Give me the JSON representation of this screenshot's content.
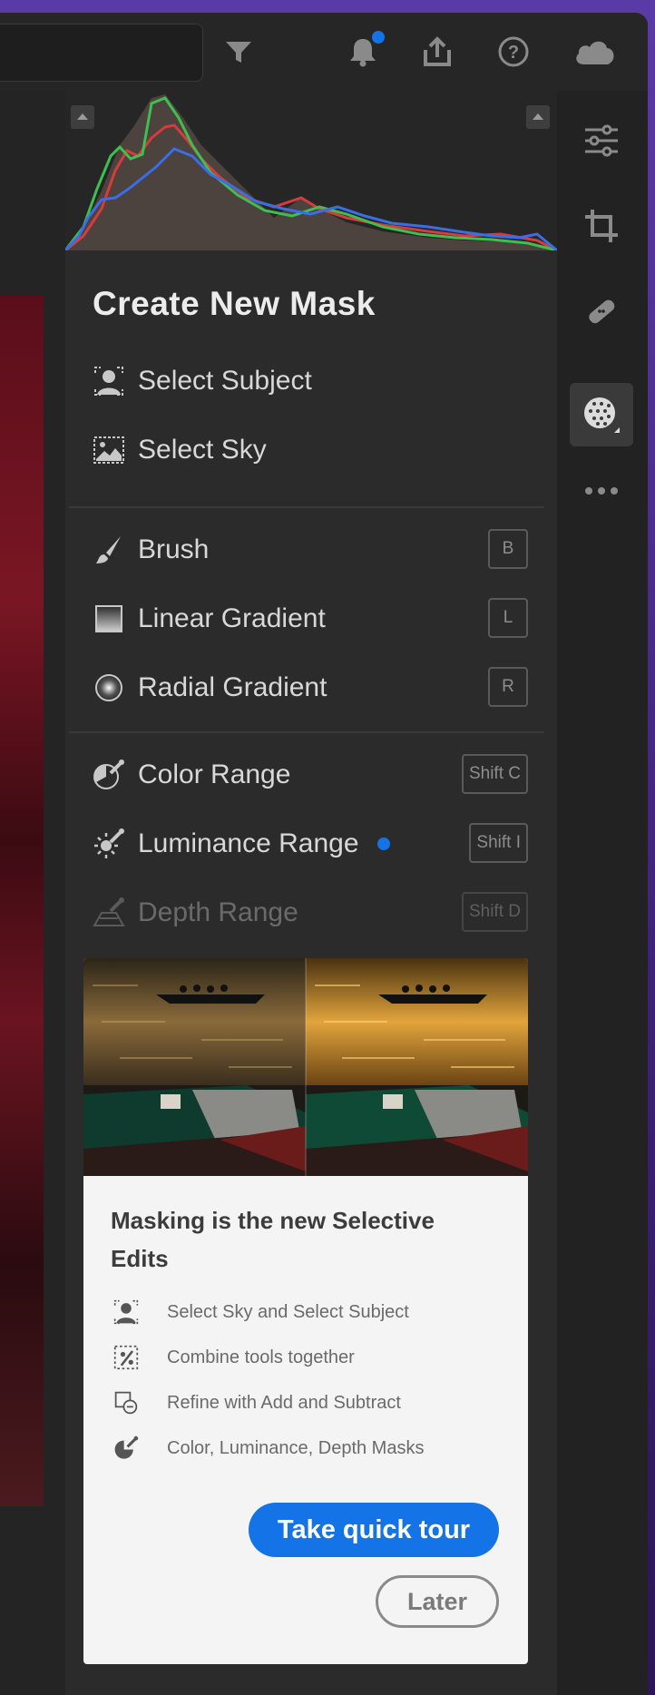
{
  "topbar": {
    "icons": [
      "filter-icon",
      "bell-icon",
      "share-icon",
      "help-icon",
      "cloud-icon"
    ],
    "notification_dot_color": "#1473e6"
  },
  "right_panel": {
    "icons": [
      "sliders-icon",
      "crop-icon",
      "healing-icon",
      "masking-icon",
      "more-icon"
    ],
    "active": "masking-icon"
  },
  "mask_panel": {
    "title": "Create New Mask",
    "group1": [
      {
        "label": "Select Subject",
        "icon": "subject-icon"
      },
      {
        "label": "Select Sky",
        "icon": "sky-icon"
      }
    ],
    "group2": [
      {
        "label": "Brush",
        "icon": "brush-icon",
        "shortcut": "B"
      },
      {
        "label": "Linear Gradient",
        "icon": "linear-gradient-icon",
        "shortcut": "L"
      },
      {
        "label": "Radial Gradient",
        "icon": "radial-gradient-icon",
        "shortcut": "R"
      }
    ],
    "group3": [
      {
        "label": "Color Range",
        "icon": "color-range-icon",
        "shortcut": "Shift C"
      },
      {
        "label": "Luminance Range",
        "icon": "luminance-range-icon",
        "shortcut": "Shift I",
        "new": true
      },
      {
        "label": "Depth Range",
        "icon": "depth-range-icon",
        "shortcut": "Shift D",
        "disabled": true
      }
    ]
  },
  "promo": {
    "title": "Masking is the new Selective Edits",
    "features": [
      {
        "icon": "subject-icon",
        "text": "Select Sky and Select Subject"
      },
      {
        "icon": "combine-icon",
        "text": "Combine tools together"
      },
      {
        "icon": "add-subtract-icon",
        "text": "Refine with Add and Subtract"
      },
      {
        "icon": "color-range-icon",
        "text": "Color, Luminance, Depth Masks"
      }
    ],
    "primary_button": "Take quick tour",
    "secondary_button": "Later"
  },
  "colors": {
    "accent": "#1473e6",
    "panel_bg": "#2b2b2b",
    "card_bg": "#f4f4f4"
  }
}
